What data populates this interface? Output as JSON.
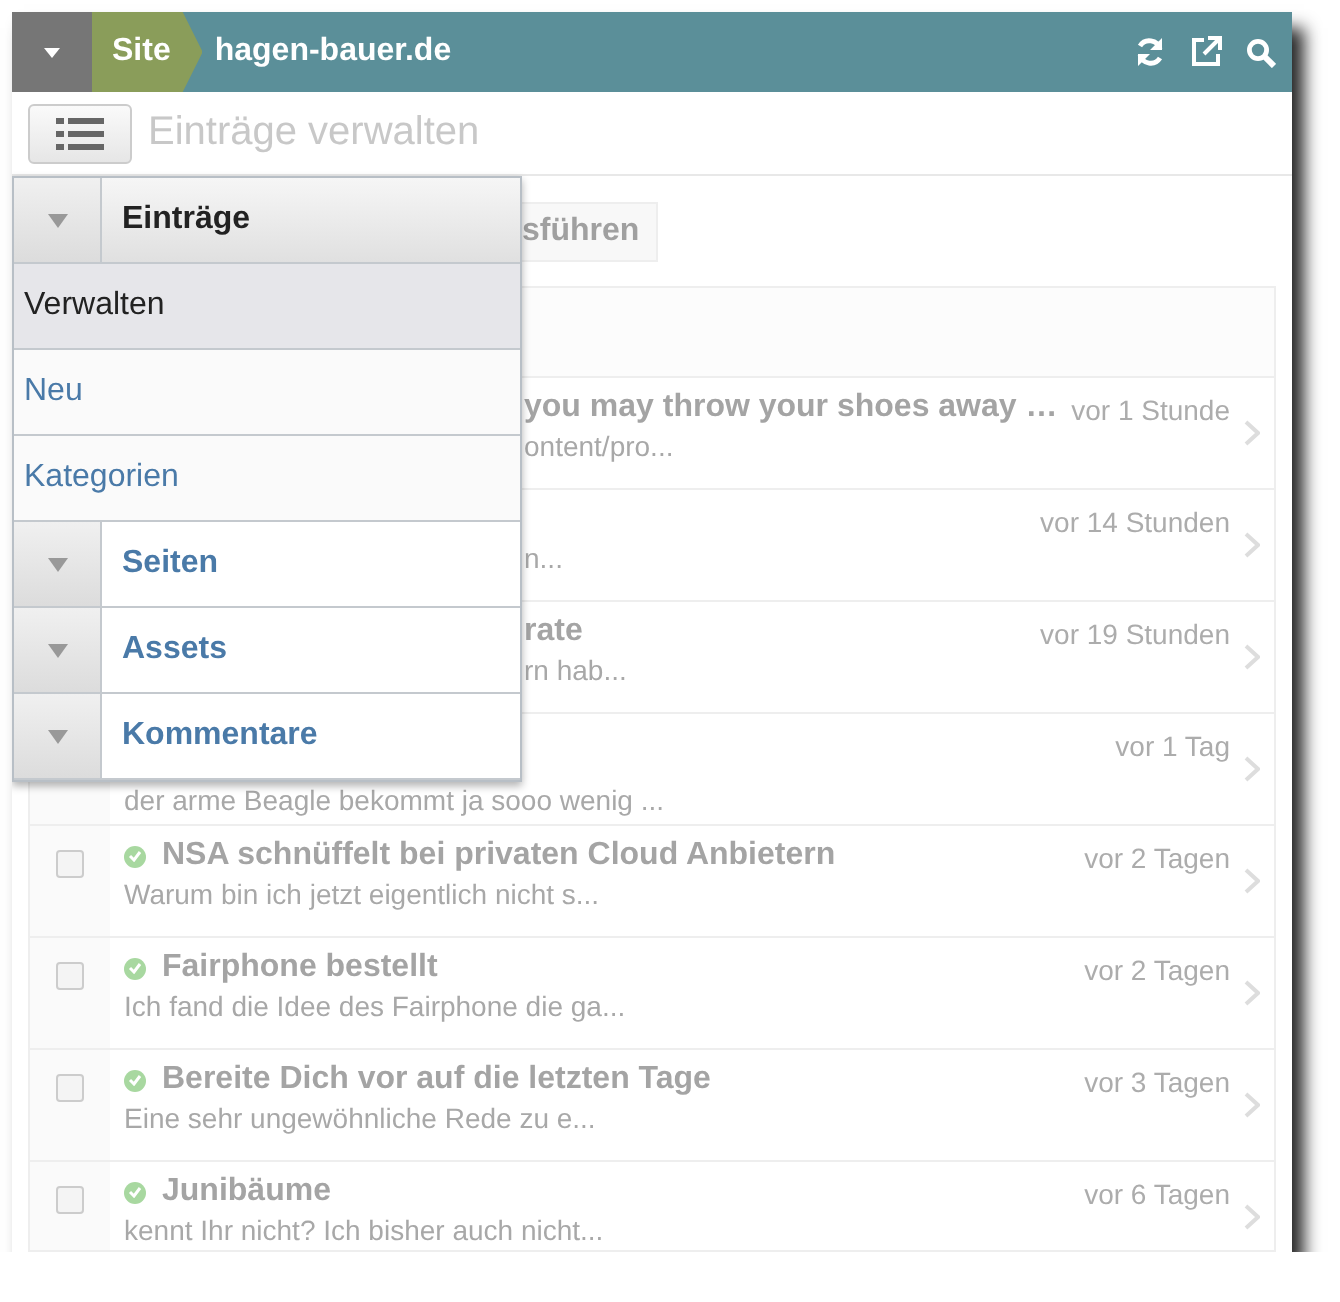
{
  "header": {
    "site_label": "Site",
    "domain": "hagen-bauer.de"
  },
  "toolbar": {
    "title": "Einträge verwalten"
  },
  "action_button": "sführen",
  "entries": [
    {
      "kind": "covered",
      "title": "you may throw your shoes away …",
      "snippet": "ontent/pro...",
      "time": "vor 1 Stunde"
    },
    {
      "kind": "covered",
      "snippet": "n...",
      "time": "vor 14 Stunden"
    },
    {
      "kind": "covered",
      "title": "rate",
      "snippet": "rn hab...",
      "time": "vor 19 Stunden"
    },
    {
      "kind": "title_hidden",
      "snippet": "der arme Beagle bekommt ja sooo wenig ...",
      "time": "vor 1 Tag"
    },
    {
      "kind": "full",
      "checked": false,
      "published": true,
      "title": "NSA schnüffelt bei privaten Cloud Anbietern",
      "snippet": "Warum bin ich jetzt eigentlich nicht s...",
      "time": "vor 2 Tagen"
    },
    {
      "kind": "full",
      "checked": false,
      "published": true,
      "title": "Fairphone bestellt",
      "snippet": "Ich fand die Idee des Fairphone die ga...",
      "time": "vor 2 Tagen"
    },
    {
      "kind": "full",
      "checked": false,
      "published": true,
      "title": "Bereite Dich vor auf die letzten Tage",
      "snippet": "Eine sehr ungewöhnliche Rede zu e...",
      "time": "vor 3 Tagen"
    },
    {
      "kind": "full",
      "checked": false,
      "published": true,
      "title": "Junibäume",
      "snippet": "kennt Ihr nicht? Ich bisher auch nicht...",
      "time": "vor 6 Tagen"
    }
  ],
  "menu": {
    "sections": [
      {
        "label": "Einträge",
        "expanded": true,
        "items": [
          {
            "label": "Verwalten",
            "selected": true
          },
          {
            "label": "Neu",
            "selected": false
          },
          {
            "label": "Kategorien",
            "selected": false
          }
        ]
      },
      {
        "label": "Seiten",
        "expanded": false
      },
      {
        "label": "Assets",
        "expanded": false
      },
      {
        "label": "Kommentare",
        "expanded": false
      }
    ]
  }
}
